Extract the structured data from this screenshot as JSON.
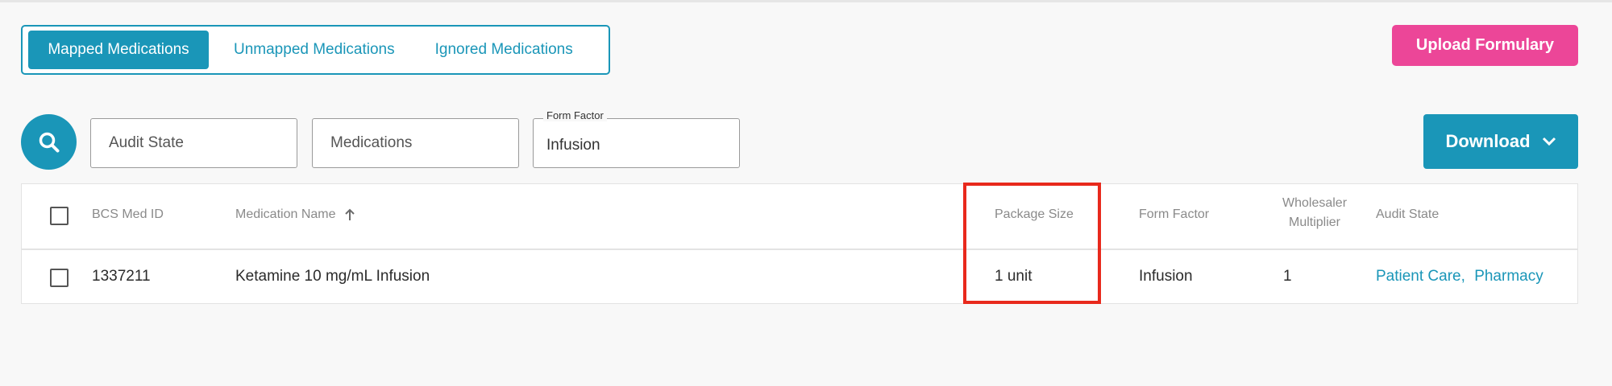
{
  "tabs": [
    {
      "label": "Mapped Medications",
      "active": true
    },
    {
      "label": "Unmapped Medications",
      "active": false
    },
    {
      "label": "Ignored Medications",
      "active": false
    }
  ],
  "upload_button": "Upload Formulary",
  "filters": {
    "audit_state_placeholder": "Audit State",
    "medications_placeholder": "Medications",
    "form_factor_label": "Form Factor",
    "form_factor_value": "Infusion"
  },
  "download_button": "Download",
  "table": {
    "headers": {
      "bcs_med_id": "BCS Med ID",
      "medication_name": "Medication Name",
      "package_size": "Package Size",
      "form_factor": "Form Factor",
      "wholesaler_multiplier_line1": "Wholesaler",
      "wholesaler_multiplier_line2": "Multiplier",
      "audit_state": "Audit State"
    },
    "rows": [
      {
        "bcs_med_id": "1337211",
        "medication_name": "Ketamine 10 mg/mL Infusion",
        "package_size": "1 unit",
        "form_factor": "Infusion",
        "wholesaler_multiplier": "1",
        "audit_state_1": "Patient Care,",
        "audit_state_2": "Pharmacy"
      }
    ]
  },
  "colors": {
    "accent": "#1a96b8",
    "upload": "#ec4698",
    "highlight": "#e8291c"
  }
}
